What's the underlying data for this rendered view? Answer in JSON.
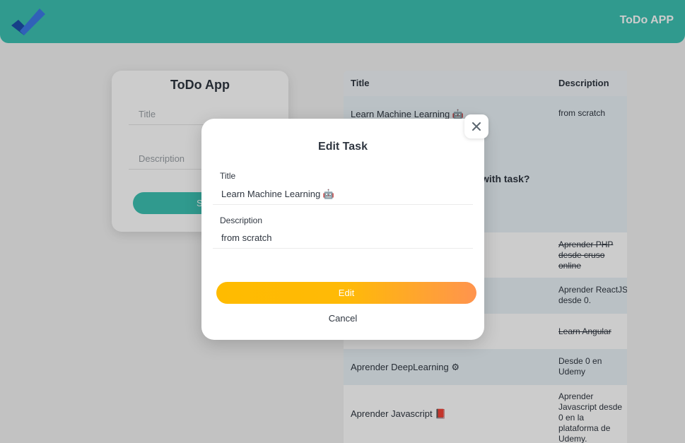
{
  "header": {
    "brand": "ToDo APP",
    "logo_icon": "checkmark-logo-icon",
    "bg_color": "#3cc1b2"
  },
  "form": {
    "title": "ToDo App",
    "title_placeholder": "Title",
    "description_placeholder": "Description",
    "save_label": "Sa"
  },
  "table": {
    "headers": [
      "Title",
      "Description"
    ],
    "rows": [
      {
        "title": "Learn Machine Learning 🤖",
        "description": "from scratch",
        "done": false
      },
      {
        "title": "",
        "description": "Aprender PHP desde cruso online",
        "done": true
      },
      {
        "title": "",
        "description": "Aprender ReactJS desde 0.",
        "done": false
      },
      {
        "title": "",
        "description": "Learn Angular",
        "done": true
      },
      {
        "title": "Aprender DeepLearning ⚙",
        "description": "Desde 0 en Udemy",
        "done": false
      },
      {
        "title": "Aprender Javascript 📕",
        "description": "Aprender Javascript desde 0 en la plataforma de Udemy.",
        "done": false
      }
    ],
    "partial_prompt": "with task?"
  },
  "modal": {
    "title": "Edit Task",
    "title_label": "Title",
    "title_value": "Learn Machine Learning 🤖",
    "description_label": "Description",
    "description_value": "from scratch",
    "edit_label": "Edit",
    "cancel_label": "Cancel",
    "close_icon": "close-icon",
    "edit_gradient": [
      "#ffbb00",
      "#ff944e"
    ]
  }
}
